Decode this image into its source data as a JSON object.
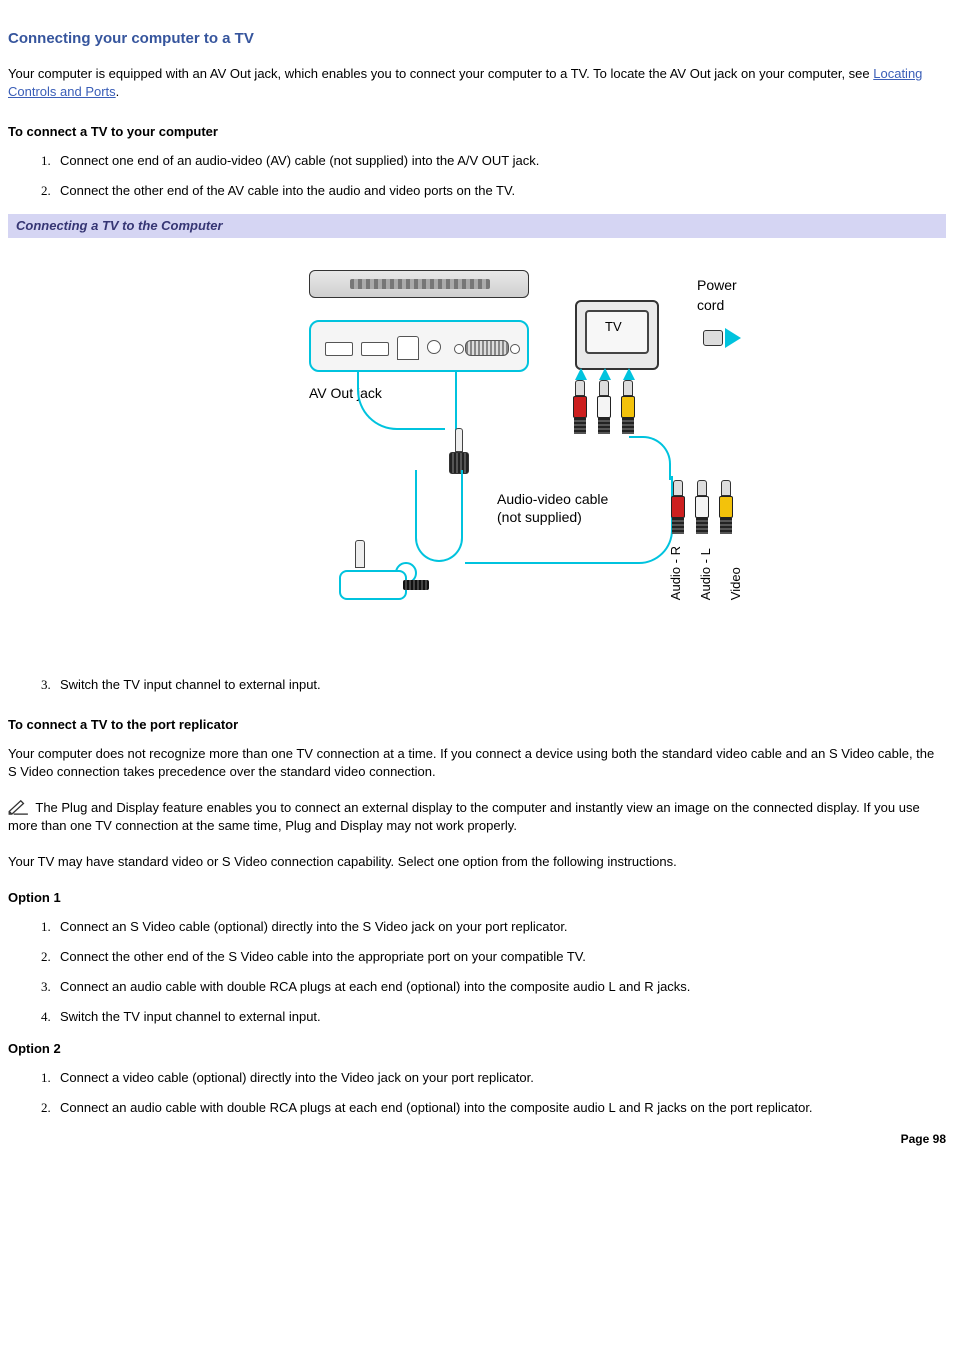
{
  "title": "Connecting your computer to a TV",
  "intro_a": "Your computer is equipped with an AV Out jack, which enables you to connect your computer to a TV. To locate the AV Out jack on your computer, see ",
  "intro_link": "Locating Controls and Ports",
  "intro_b": ".",
  "sub1": "To connect a TV to your computer",
  "steps1": [
    "Connect one end of an audio-video (AV) cable (not supplied) into the A/V OUT jack.",
    "Connect the other end of the AV cable into the audio and video ports on the TV."
  ],
  "caption": "Connecting a TV to the Computer",
  "diagram": {
    "power": "Power cord",
    "tv": "TV",
    "avout": "AV Out jack",
    "avcable_l1": "Audio-video cable",
    "avcable_l2": "(not supplied)",
    "ar": "Audio - R",
    "al": "Audio - L",
    "vid": "Video"
  },
  "steps1b": [
    "Switch the TV input channel to external input."
  ],
  "sub2": "To connect a TV to the port replicator",
  "para2": "Your computer does not recognize more than one TV connection at a time. If you connect a device using both the standard video cable and an S Video cable, the S Video connection takes precedence over the standard video connection.",
  "note": " The Plug and Display feature enables you to connect an external display to the computer and instantly view an image on the connected display. If you use more than one TV connection at the same time, Plug and Display may not work properly.",
  "para3": "Your TV may have standard video or S Video connection capability. Select one option from the following instructions.",
  "opt1": "Option 1",
  "opt1_steps": [
    "Connect an S Video cable (optional) directly into the S Video jack on your port replicator.",
    "Connect the other end of the S Video cable into the appropriate port on your compatible TV.",
    "Connect an audio cable with double RCA plugs at each end (optional) into the composite audio L and R jacks.",
    "Switch the TV input channel to external input."
  ],
  "opt2": "Option 2",
  "opt2_steps": [
    "Connect a video cable (optional) directly into the Video jack on your port replicator.",
    "Connect an audio cable with double RCA plugs at each end (optional) into the composite audio L and R jacks on the port replicator."
  ],
  "page": "Page 98"
}
